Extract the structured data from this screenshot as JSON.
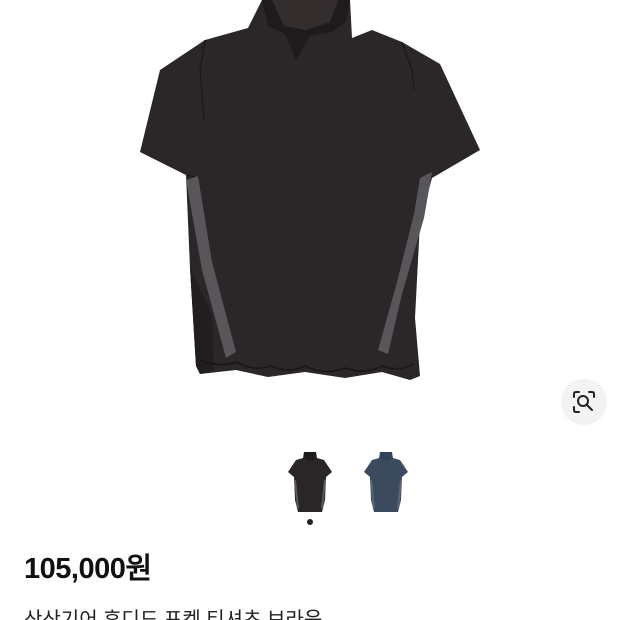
{
  "product": {
    "price": "105,000원",
    "title": "산산기어 후디드 포켓 티셔츠 브라운",
    "variants": [
      {
        "color_name": "brown",
        "color": "#2a2526",
        "selected": true
      },
      {
        "color_name": "navy",
        "color": "#3c4a5e",
        "selected": false
      }
    ],
    "image_count": 2,
    "current_image": 1
  },
  "icons": {
    "lens": "visual-search-lens-icon"
  }
}
